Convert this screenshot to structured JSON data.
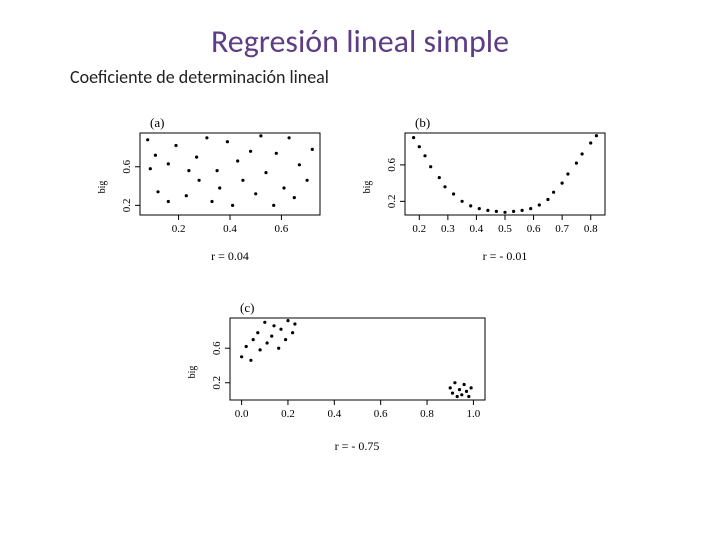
{
  "title": "Regresión lineal simple",
  "subtitle": "Coeficiente de determinación lineal",
  "panels": {
    "a": {
      "label": "(a)",
      "xticks": [
        "0.2",
        "0.4",
        "0.6"
      ],
      "yticks": [
        "0.2",
        "0.6"
      ],
      "ylabel_big": "big",
      "r_text": "r = 0.04"
    },
    "b": {
      "label": "(b)",
      "xticks": [
        "0.2",
        "0.3",
        "0.4",
        "0.5",
        "0.6",
        "0.7",
        "0.8"
      ],
      "yticks": [
        "0.2",
        "0.6"
      ],
      "ylabel_big": "big",
      "r_text": "r = - 0.01"
    },
    "c": {
      "label": "(c)",
      "xticks": [
        "0.0",
        "0.2",
        "0.4",
        "0.6",
        "0.8",
        "1.0"
      ],
      "yticks": [
        "0.2",
        "0.6"
      ],
      "ylabel_big": "big",
      "r_text": "r = - 0.75"
    }
  },
  "chart_data": [
    {
      "id": "a",
      "type": "scatter",
      "title": "(a)",
      "xlim": [
        0.05,
        0.75
      ],
      "ylim": [
        0.1,
        0.95
      ],
      "xticks_vals": [
        0.2,
        0.4,
        0.6
      ],
      "yticks_vals": [
        0.2,
        0.6
      ],
      "r": 0.04,
      "points": [
        [
          0.08,
          0.88
        ],
        [
          0.09,
          0.58
        ],
        [
          0.11,
          0.72
        ],
        [
          0.12,
          0.34
        ],
        [
          0.16,
          0.63
        ],
        [
          0.16,
          0.24
        ],
        [
          0.19,
          0.82
        ],
        [
          0.23,
          0.3
        ],
        [
          0.24,
          0.56
        ],
        [
          0.27,
          0.7
        ],
        [
          0.28,
          0.46
        ],
        [
          0.31,
          0.9
        ],
        [
          0.33,
          0.24
        ],
        [
          0.35,
          0.56
        ],
        [
          0.36,
          0.38
        ],
        [
          0.39,
          0.86
        ],
        [
          0.41,
          0.2
        ],
        [
          0.43,
          0.66
        ],
        [
          0.45,
          0.46
        ],
        [
          0.48,
          0.76
        ],
        [
          0.5,
          0.32
        ],
        [
          0.52,
          0.92
        ],
        [
          0.54,
          0.54
        ],
        [
          0.57,
          0.2
        ],
        [
          0.58,
          0.74
        ],
        [
          0.61,
          0.38
        ],
        [
          0.63,
          0.9
        ],
        [
          0.65,
          0.28
        ],
        [
          0.67,
          0.62
        ],
        [
          0.7,
          0.46
        ],
        [
          0.72,
          0.78
        ]
      ]
    },
    {
      "id": "b",
      "type": "scatter",
      "title": "(b)",
      "xlim": [
        0.15,
        0.85
      ],
      "ylim": [
        0.05,
        0.95
      ],
      "xticks_vals": [
        0.2,
        0.3,
        0.4,
        0.5,
        0.6,
        0.7,
        0.8
      ],
      "yticks_vals": [
        0.2,
        0.6
      ],
      "r": -0.01,
      "points": [
        [
          0.18,
          0.9
        ],
        [
          0.2,
          0.8
        ],
        [
          0.22,
          0.7
        ],
        [
          0.24,
          0.58
        ],
        [
          0.27,
          0.46
        ],
        [
          0.29,
          0.36
        ],
        [
          0.32,
          0.28
        ],
        [
          0.35,
          0.2
        ],
        [
          0.38,
          0.15
        ],
        [
          0.41,
          0.12
        ],
        [
          0.44,
          0.1
        ],
        [
          0.47,
          0.09
        ],
        [
          0.5,
          0.08
        ],
        [
          0.53,
          0.09
        ],
        [
          0.56,
          0.1
        ],
        [
          0.59,
          0.12
        ],
        [
          0.62,
          0.16
        ],
        [
          0.65,
          0.22
        ],
        [
          0.67,
          0.3
        ],
        [
          0.7,
          0.4
        ],
        [
          0.72,
          0.5
        ],
        [
          0.75,
          0.62
        ],
        [
          0.77,
          0.72
        ],
        [
          0.8,
          0.84
        ],
        [
          0.82,
          0.92
        ]
      ]
    },
    {
      "id": "c",
      "type": "scatter",
      "title": "(c)",
      "xlim": [
        -0.05,
        1.05
      ],
      "ylim": [
        0.0,
        0.95
      ],
      "xticks_vals": [
        0.0,
        0.2,
        0.4,
        0.6,
        0.8,
        1.0
      ],
      "yticks_vals": [
        0.2,
        0.6
      ],
      "r": -0.75,
      "points": [
        [
          0.0,
          0.5
        ],
        [
          0.02,
          0.62
        ],
        [
          0.04,
          0.46
        ],
        [
          0.05,
          0.7
        ],
        [
          0.07,
          0.78
        ],
        [
          0.08,
          0.58
        ],
        [
          0.1,
          0.9
        ],
        [
          0.11,
          0.66
        ],
        [
          0.13,
          0.74
        ],
        [
          0.14,
          0.86
        ],
        [
          0.16,
          0.6
        ],
        [
          0.17,
          0.82
        ],
        [
          0.19,
          0.7
        ],
        [
          0.2,
          0.92
        ],
        [
          0.22,
          0.78
        ],
        [
          0.23,
          0.88
        ],
        [
          0.9,
          0.14
        ],
        [
          0.91,
          0.08
        ],
        [
          0.92,
          0.2
        ],
        [
          0.93,
          0.04
        ],
        [
          0.94,
          0.12
        ],
        [
          0.95,
          0.06
        ],
        [
          0.96,
          0.18
        ],
        [
          0.97,
          0.1
        ],
        [
          0.98,
          0.04
        ],
        [
          0.99,
          0.14
        ]
      ]
    }
  ]
}
